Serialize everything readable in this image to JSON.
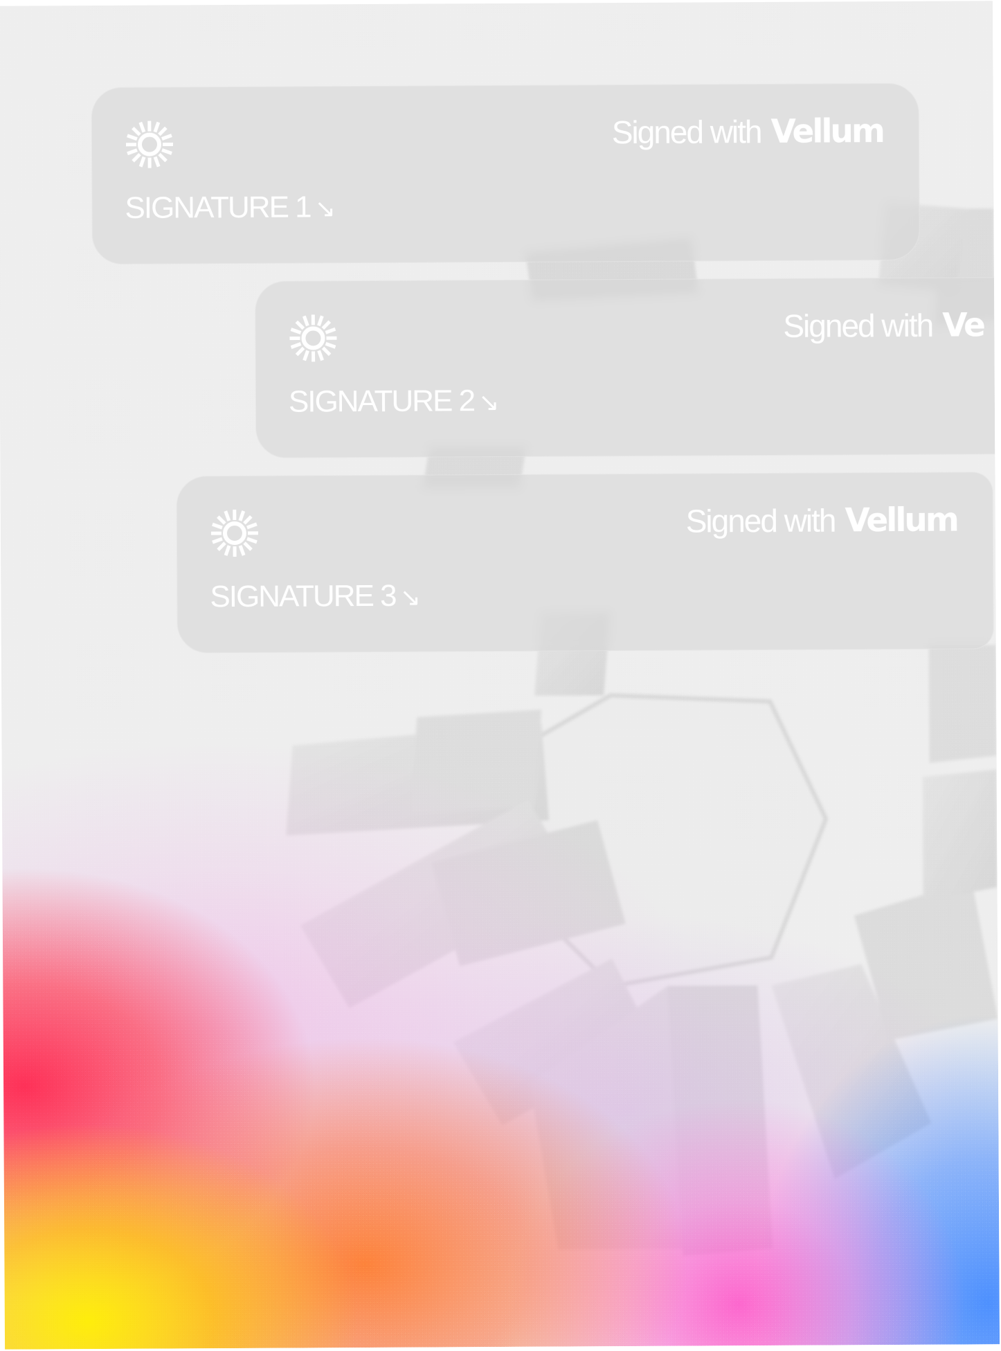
{
  "cards": [
    {
      "label": "SIGNATURE 1",
      "arrow": "↘",
      "signed_text": "Signed with",
      "brand": "Vellum"
    },
    {
      "label": "SIGNATURE 2",
      "arrow": "↘",
      "signed_text": "Signed with",
      "brand": "Ve"
    },
    {
      "label": "SIGNATURE 3",
      "arrow": "↘",
      "signed_text": "Signed with",
      "brand": "Vellum"
    }
  ],
  "colors": {
    "background": "#eeeeee",
    "card": "#d6d6d6",
    "text": "#ffffff",
    "gradient": [
      "#ffee00",
      "#ff2850",
      "#ff7828",
      "#ff50c8",
      "#468cff"
    ]
  },
  "icons": {
    "card_icon": "sunburst-icon",
    "label_arrow": "arrow-down-right-icon"
  }
}
